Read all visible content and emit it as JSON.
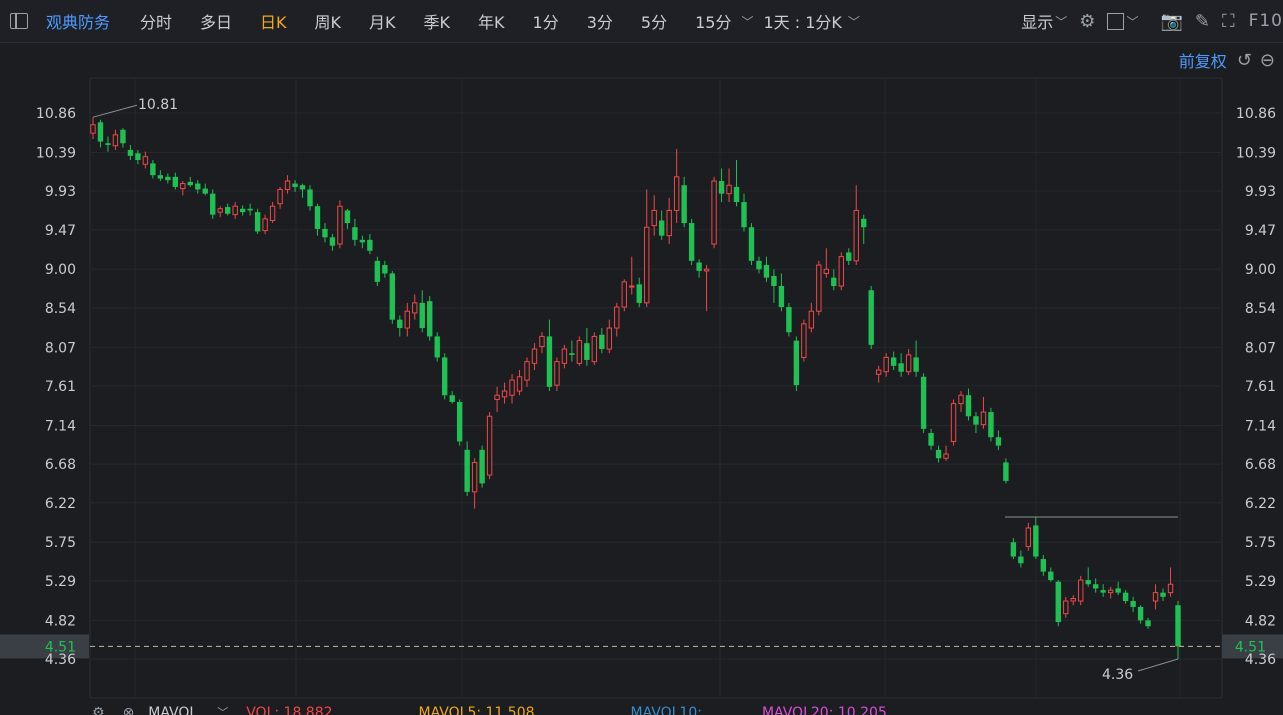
{
  "toolbar": {
    "stock_name": "观典防务",
    "tabs": [
      {
        "label": "分时",
        "active": false
      },
      {
        "label": "多日",
        "active": false
      },
      {
        "label": "日K",
        "active": true
      },
      {
        "label": "周K",
        "active": false
      },
      {
        "label": "月K",
        "active": false
      },
      {
        "label": "季K",
        "active": false
      },
      {
        "label": "年K",
        "active": false
      },
      {
        "label": "1分",
        "active": false
      },
      {
        "label": "3分",
        "active": false
      },
      {
        "label": "5分",
        "active": false
      },
      {
        "label": "15分",
        "active": false
      }
    ],
    "period_select": "1天 : 1分K",
    "display_label": "显示",
    "f10_label": "F10"
  },
  "subbar": {
    "adjust_label": "前复权"
  },
  "price_axis": {
    "ticks": [
      "10.86",
      "10.39",
      "9.93",
      "9.47",
      "9.00",
      "8.54",
      "8.07",
      "7.61",
      "7.14",
      "6.68",
      "6.22",
      "5.75",
      "5.29",
      "4.82",
      "4.36"
    ],
    "current_price": "4.51"
  },
  "annotations": {
    "high_label": "10.81",
    "low_label": "4.36"
  },
  "volume_bar": {
    "indicator": "MAVOL",
    "vol": "VOL: 18.882",
    "ma5": "MAVOL5: 11.508",
    "ma10": "MAVOL10: ",
    "ma20": "MAVOL20: 10.205"
  },
  "colors": {
    "up": "#f04848",
    "down": "#1fc155",
    "accent": "#4d9bff",
    "active_tab": "#f0a91d"
  },
  "chart_data": {
    "type": "candlestick",
    "ylim": [
      4.36,
      10.86
    ],
    "current_price": 4.51,
    "high": 10.81,
    "low": 4.36,
    "candles": [
      {
        "o": 10.62,
        "h": 10.81,
        "l": 10.55,
        "c": 10.72
      },
      {
        "o": 10.75,
        "h": 10.78,
        "l": 10.45,
        "c": 10.52
      },
      {
        "o": 10.5,
        "h": 10.58,
        "l": 10.4,
        "c": 10.48
      },
      {
        "o": 10.47,
        "h": 10.66,
        "l": 10.42,
        "c": 10.6
      },
      {
        "o": 10.66,
        "h": 10.68,
        "l": 10.45,
        "c": 10.5
      },
      {
        "o": 10.42,
        "h": 10.48,
        "l": 10.3,
        "c": 10.35
      },
      {
        "o": 10.38,
        "h": 10.42,
        "l": 10.25,
        "c": 10.3
      },
      {
        "o": 10.25,
        "h": 10.4,
        "l": 10.2,
        "c": 10.34
      },
      {
        "o": 10.26,
        "h": 10.3,
        "l": 10.08,
        "c": 10.12
      },
      {
        "o": 10.12,
        "h": 10.18,
        "l": 10.05,
        "c": 10.08
      },
      {
        "o": 10.1,
        "h": 10.14,
        "l": 10.02,
        "c": 10.06
      },
      {
        "o": 10.1,
        "h": 10.15,
        "l": 9.95,
        "c": 9.98
      },
      {
        "o": 9.96,
        "h": 10.05,
        "l": 9.88,
        "c": 10.02
      },
      {
        "o": 10.04,
        "h": 10.1,
        "l": 9.98,
        "c": 10.0
      },
      {
        "o": 10.02,
        "h": 10.06,
        "l": 9.9,
        "c": 9.95
      },
      {
        "o": 9.96,
        "h": 10.02,
        "l": 9.88,
        "c": 9.9
      },
      {
        "o": 9.9,
        "h": 9.95,
        "l": 9.6,
        "c": 9.65
      },
      {
        "o": 9.68,
        "h": 9.75,
        "l": 9.62,
        "c": 9.72
      },
      {
        "o": 9.74,
        "h": 9.78,
        "l": 9.64,
        "c": 9.66
      },
      {
        "o": 9.65,
        "h": 9.8,
        "l": 9.6,
        "c": 9.75
      },
      {
        "o": 9.72,
        "h": 9.76,
        "l": 9.64,
        "c": 9.68
      },
      {
        "o": 9.72,
        "h": 9.78,
        "l": 9.64,
        "c": 9.7
      },
      {
        "o": 9.68,
        "h": 9.72,
        "l": 9.42,
        "c": 9.45
      },
      {
        "o": 9.46,
        "h": 9.65,
        "l": 9.42,
        "c": 9.6
      },
      {
        "o": 9.58,
        "h": 9.8,
        "l": 9.55,
        "c": 9.75
      },
      {
        "o": 9.78,
        "h": 9.98,
        "l": 9.72,
        "c": 9.95
      },
      {
        "o": 9.95,
        "h": 10.12,
        "l": 9.9,
        "c": 10.05
      },
      {
        "o": 10.02,
        "h": 10.06,
        "l": 9.92,
        "c": 9.98
      },
      {
        "o": 10.0,
        "h": 10.02,
        "l": 9.85,
        "c": 9.95
      },
      {
        "o": 9.95,
        "h": 10.0,
        "l": 9.7,
        "c": 9.75
      },
      {
        "o": 9.75,
        "h": 9.78,
        "l": 9.4,
        "c": 9.48
      },
      {
        "o": 9.48,
        "h": 9.55,
        "l": 9.32,
        "c": 9.38
      },
      {
        "o": 9.38,
        "h": 9.42,
        "l": 9.22,
        "c": 9.28
      },
      {
        "o": 9.3,
        "h": 9.82,
        "l": 9.25,
        "c": 9.75
      },
      {
        "o": 9.7,
        "h": 9.72,
        "l": 9.48,
        "c": 9.55
      },
      {
        "o": 9.5,
        "h": 9.6,
        "l": 9.28,
        "c": 9.35
      },
      {
        "o": 9.35,
        "h": 9.4,
        "l": 9.25,
        "c": 9.32
      },
      {
        "o": 9.35,
        "h": 9.42,
        "l": 9.18,
        "c": 9.22
      },
      {
        "o": 9.1,
        "h": 9.15,
        "l": 8.8,
        "c": 8.85
      },
      {
        "o": 9.05,
        "h": 9.1,
        "l": 8.9,
        "c": 8.95
      },
      {
        "o": 8.95,
        "h": 8.98,
        "l": 8.35,
        "c": 8.4
      },
      {
        "o": 8.4,
        "h": 8.45,
        "l": 8.2,
        "c": 8.3
      },
      {
        "o": 8.3,
        "h": 8.6,
        "l": 8.2,
        "c": 8.5
      },
      {
        "o": 8.48,
        "h": 8.7,
        "l": 8.4,
        "c": 8.6
      },
      {
        "o": 8.6,
        "h": 8.75,
        "l": 8.25,
        "c": 8.3
      },
      {
        "o": 8.62,
        "h": 8.68,
        "l": 8.15,
        "c": 8.2
      },
      {
        "o": 8.2,
        "h": 8.25,
        "l": 7.9,
        "c": 7.95
      },
      {
        "o": 7.95,
        "h": 8.0,
        "l": 7.45,
        "c": 7.5
      },
      {
        "o": 7.5,
        "h": 7.55,
        "l": 7.4,
        "c": 7.42
      },
      {
        "o": 7.42,
        "h": 7.45,
        "l": 6.9,
        "c": 6.95
      },
      {
        "o": 6.85,
        "h": 6.95,
        "l": 6.3,
        "c": 6.35
      },
      {
        "o": 6.35,
        "h": 6.75,
        "l": 6.15,
        "c": 6.7
      },
      {
        "o": 6.85,
        "h": 6.9,
        "l": 6.4,
        "c": 6.45
      },
      {
        "o": 6.55,
        "h": 7.3,
        "l": 6.5,
        "c": 7.25
      },
      {
        "o": 7.45,
        "h": 7.6,
        "l": 7.3,
        "c": 7.5
      },
      {
        "o": 7.48,
        "h": 7.65,
        "l": 7.4,
        "c": 7.55
      },
      {
        "o": 7.5,
        "h": 7.75,
        "l": 7.4,
        "c": 7.68
      },
      {
        "o": 7.55,
        "h": 7.8,
        "l": 7.5,
        "c": 7.72
      },
      {
        "o": 7.68,
        "h": 7.95,
        "l": 7.6,
        "c": 7.9
      },
      {
        "o": 7.88,
        "h": 8.12,
        "l": 7.8,
        "c": 8.05
      },
      {
        "o": 8.08,
        "h": 8.25,
        "l": 8.0,
        "c": 8.2
      },
      {
        "o": 8.2,
        "h": 8.4,
        "l": 7.55,
        "c": 7.6
      },
      {
        "o": 7.62,
        "h": 7.95,
        "l": 7.55,
        "c": 7.9
      },
      {
        "o": 7.88,
        "h": 8.1,
        "l": 7.82,
        "c": 8.05
      },
      {
        "o": 8.0,
        "h": 8.15,
        "l": 7.9,
        "c": 7.98
      },
      {
        "o": 7.88,
        "h": 8.2,
        "l": 7.85,
        "c": 8.15
      },
      {
        "o": 8.12,
        "h": 8.3,
        "l": 7.85,
        "c": 7.92
      },
      {
        "o": 7.9,
        "h": 8.25,
        "l": 7.86,
        "c": 8.2
      },
      {
        "o": 8.22,
        "h": 8.3,
        "l": 8.0,
        "c": 8.05
      },
      {
        "o": 8.05,
        "h": 8.4,
        "l": 8.0,
        "c": 8.3
      },
      {
        "o": 8.3,
        "h": 8.6,
        "l": 8.2,
        "c": 8.55
      },
      {
        "o": 8.55,
        "h": 8.88,
        "l": 8.5,
        "c": 8.85
      },
      {
        "o": 8.8,
        "h": 9.15,
        "l": 8.7,
        "c": 8.8
      },
      {
        "o": 8.82,
        "h": 8.9,
        "l": 8.55,
        "c": 8.6
      },
      {
        "o": 8.6,
        "h": 9.95,
        "l": 8.55,
        "c": 9.5
      },
      {
        "o": 9.52,
        "h": 9.88,
        "l": 9.4,
        "c": 9.7
      },
      {
        "o": 9.58,
        "h": 9.7,
        "l": 9.35,
        "c": 9.4
      },
      {
        "o": 9.4,
        "h": 9.85,
        "l": 9.3,
        "c": 9.7
      },
      {
        "o": 9.7,
        "h": 10.43,
        "l": 9.55,
        "c": 10.1
      },
      {
        "o": 10.0,
        "h": 10.1,
        "l": 9.5,
        "c": 9.55
      },
      {
        "o": 9.55,
        "h": 9.6,
        "l": 9.05,
        "c": 9.1
      },
      {
        "o": 9.08,
        "h": 9.12,
        "l": 8.9,
        "c": 8.98
      },
      {
        "o": 8.98,
        "h": 9.05,
        "l": 8.5,
        "c": 9.0
      },
      {
        "o": 9.3,
        "h": 10.1,
        "l": 9.25,
        "c": 10.05
      },
      {
        "o": 10.05,
        "h": 10.2,
        "l": 9.8,
        "c": 9.9
      },
      {
        "o": 9.9,
        "h": 10.2,
        "l": 9.8,
        "c": 10.0
      },
      {
        "o": 9.98,
        "h": 10.3,
        "l": 9.75,
        "c": 9.8
      },
      {
        "o": 9.8,
        "h": 9.9,
        "l": 9.45,
        "c": 9.5
      },
      {
        "o": 9.5,
        "h": 9.55,
        "l": 9.05,
        "c": 9.1
      },
      {
        "o": 9.1,
        "h": 9.15,
        "l": 8.95,
        "c": 9.0
      },
      {
        "o": 9.05,
        "h": 9.15,
        "l": 8.85,
        "c": 8.9
      },
      {
        "o": 8.92,
        "h": 9.0,
        "l": 8.6,
        "c": 8.8
      },
      {
        "o": 8.8,
        "h": 8.95,
        "l": 8.5,
        "c": 8.55
      },
      {
        "o": 8.55,
        "h": 8.6,
        "l": 8.2,
        "c": 8.25
      },
      {
        "o": 8.15,
        "h": 8.2,
        "l": 7.55,
        "c": 7.62
      },
      {
        "o": 7.95,
        "h": 8.4,
        "l": 7.9,
        "c": 8.35
      },
      {
        "o": 8.3,
        "h": 8.6,
        "l": 8.25,
        "c": 8.5
      },
      {
        "o": 8.5,
        "h": 9.1,
        "l": 8.45,
        "c": 9.05
      },
      {
        "o": 8.95,
        "h": 9.25,
        "l": 8.9,
        "c": 9.0
      },
      {
        "o": 8.9,
        "h": 9.0,
        "l": 8.75,
        "c": 8.8
      },
      {
        "o": 8.8,
        "h": 9.2,
        "l": 8.75,
        "c": 9.15
      },
      {
        "o": 9.2,
        "h": 9.25,
        "l": 9.05,
        "c": 9.1
      },
      {
        "o": 9.1,
        "h": 10.0,
        "l": 9.05,
        "c": 9.7
      },
      {
        "o": 9.6,
        "h": 9.65,
        "l": 9.3,
        "c": 9.5
      },
      {
        "o": 8.75,
        "h": 8.8,
        "l": 8.05,
        "c": 8.1
      },
      {
        "o": 7.75,
        "h": 7.85,
        "l": 7.65,
        "c": 7.8
      },
      {
        "o": 7.78,
        "h": 8.0,
        "l": 7.72,
        "c": 7.95
      },
      {
        "o": 7.95,
        "h": 8.02,
        "l": 7.8,
        "c": 7.85
      },
      {
        "o": 7.88,
        "h": 8.0,
        "l": 7.72,
        "c": 7.78
      },
      {
        "o": 7.78,
        "h": 8.05,
        "l": 7.74,
        "c": 7.98
      },
      {
        "o": 7.95,
        "h": 8.15,
        "l": 7.72,
        "c": 7.78
      },
      {
        "o": 7.72,
        "h": 7.76,
        "l": 7.05,
        "c": 7.1
      },
      {
        "o": 7.05,
        "h": 7.1,
        "l": 6.85,
        "c": 6.9
      },
      {
        "o": 6.85,
        "h": 6.9,
        "l": 6.7,
        "c": 6.75
      },
      {
        "o": 6.75,
        "h": 6.9,
        "l": 6.72,
        "c": 6.8
      },
      {
        "o": 6.95,
        "h": 7.45,
        "l": 6.9,
        "c": 7.4
      },
      {
        "o": 7.4,
        "h": 7.55,
        "l": 7.3,
        "c": 7.5
      },
      {
        "o": 7.5,
        "h": 7.58,
        "l": 7.2,
        "c": 7.25
      },
      {
        "o": 7.25,
        "h": 7.3,
        "l": 7.05,
        "c": 7.15
      },
      {
        "o": 7.15,
        "h": 7.48,
        "l": 7.1,
        "c": 7.3
      },
      {
        "o": 7.3,
        "h": 7.35,
        "l": 6.95,
        "c": 7.0
      },
      {
        "o": 7.0,
        "h": 7.08,
        "l": 6.85,
        "c": 6.9
      },
      {
        "o": 6.7,
        "h": 6.75,
        "l": 6.45,
        "c": 6.48
      },
      {
        "o": 5.75,
        "h": 5.8,
        "l": 5.55,
        "c": 5.58
      },
      {
        "o": 5.58,
        "h": 5.65,
        "l": 5.45,
        "c": 5.5
      },
      {
        "o": 5.7,
        "h": 5.98,
        "l": 5.65,
        "c": 5.92
      },
      {
        "o": 5.95,
        "h": 6.05,
        "l": 5.55,
        "c": 5.58
      },
      {
        "o": 5.55,
        "h": 5.6,
        "l": 5.35,
        "c": 5.4
      },
      {
        "o": 5.4,
        "h": 5.45,
        "l": 5.28,
        "c": 5.3
      },
      {
        "o": 5.28,
        "h": 5.3,
        "l": 4.75,
        "c": 4.8
      },
      {
        "o": 4.9,
        "h": 5.1,
        "l": 4.85,
        "c": 5.05
      },
      {
        "o": 5.05,
        "h": 5.12,
        "l": 5.0,
        "c": 5.08
      },
      {
        "o": 5.05,
        "h": 5.35,
        "l": 5.0,
        "c": 5.3
      },
      {
        "o": 5.3,
        "h": 5.45,
        "l": 5.22,
        "c": 5.25
      },
      {
        "o": 5.25,
        "h": 5.32,
        "l": 5.15,
        "c": 5.2
      },
      {
        "o": 5.18,
        "h": 5.25,
        "l": 5.1,
        "c": 5.15
      },
      {
        "o": 5.15,
        "h": 5.22,
        "l": 5.08,
        "c": 5.18
      },
      {
        "o": 5.2,
        "h": 5.28,
        "l": 5.12,
        "c": 5.15
      },
      {
        "o": 5.15,
        "h": 5.18,
        "l": 5.02,
        "c": 5.05
      },
      {
        "o": 5.05,
        "h": 5.1,
        "l": 4.92,
        "c": 4.98
      },
      {
        "o": 4.98,
        "h": 5.0,
        "l": 4.78,
        "c": 4.82
      },
      {
        "o": 4.82,
        "h": 4.85,
        "l": 4.72,
        "c": 4.75
      },
      {
        "o": 5.05,
        "h": 5.25,
        "l": 4.95,
        "c": 5.15
      },
      {
        "o": 5.15,
        "h": 5.2,
        "l": 5.05,
        "c": 5.1
      },
      {
        "o": 5.15,
        "h": 5.45,
        "l": 5.1,
        "c": 5.25
      },
      {
        "o": 5.0,
        "h": 5.05,
        "l": 4.36,
        "c": 4.51
      }
    ]
  }
}
